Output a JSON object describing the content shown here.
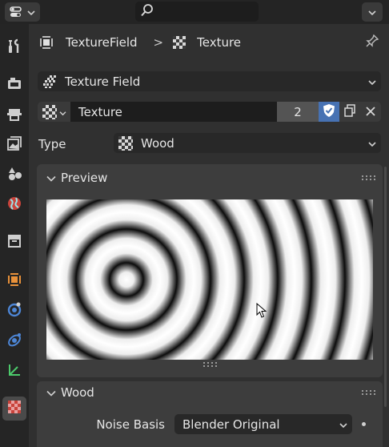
{
  "header": {
    "editor_type_icon": "properties-editor-icon",
    "dropdown_icon": "chevron-down-icon",
    "search_icon": "search-icon",
    "search_placeholder": "",
    "options_icon": "chevron-down-icon"
  },
  "tabs": [
    {
      "name": "tool-tab",
      "icon": "wrench-screwdriver-icon"
    },
    {
      "name": "render-tab",
      "icon": "camera-back-icon"
    },
    {
      "name": "output-tab",
      "icon": "printer-icon"
    },
    {
      "name": "view-layer-tab",
      "icon": "images-icon"
    },
    {
      "name": "scene-tab",
      "icon": "scene-shapes-icon"
    },
    {
      "name": "world-tab",
      "icon": "globe-icon"
    },
    {
      "name": "collection-tab",
      "icon": "box-icon"
    },
    {
      "name": "object-tab",
      "icon": "object-square-icon"
    },
    {
      "name": "modifiers-tab",
      "icon": "blue-orb-icon"
    },
    {
      "name": "physics-tab",
      "icon": "orbit-icon"
    },
    {
      "name": "constraints-tab",
      "icon": "axis-icon"
    },
    {
      "name": "texture-tab",
      "icon": "checker-texture-icon"
    }
  ],
  "breadcrumb": {
    "object": "TextureField",
    "separator": ">",
    "texture": "Texture"
  },
  "texture_user": {
    "label": "Texture Field"
  },
  "texture_block": {
    "name": "Texture",
    "users": "2"
  },
  "type_row": {
    "label": "Type",
    "value": "Wood"
  },
  "preview_panel": {
    "title": "Preview"
  },
  "wood_panel": {
    "title": "Wood",
    "noise_basis_label": "Noise Basis",
    "noise_basis_value": "Blender Original"
  },
  "colors": {
    "accent": "#4772b3",
    "orange": "#e8913a",
    "background": "#303030",
    "field": "#282828"
  }
}
